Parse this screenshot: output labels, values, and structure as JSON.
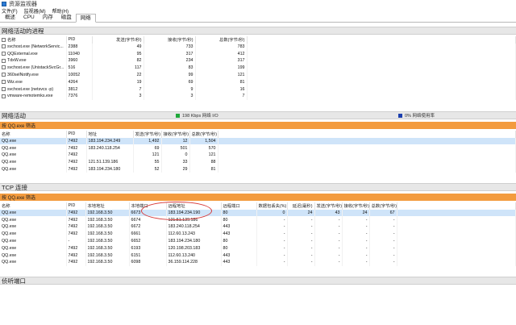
{
  "window": {
    "title": "资源监视器"
  },
  "menu": [
    "文件(F)",
    "监视器(M)",
    "帮助(H)"
  ],
  "tabs": [
    {
      "label": "概述",
      "active": false
    },
    {
      "label": "CPU",
      "active": false
    },
    {
      "label": "内存",
      "active": false
    },
    {
      "label": "磁盘",
      "active": false
    },
    {
      "label": "网络",
      "active": true
    }
  ],
  "processes": {
    "title": "网络活动的进程",
    "columns": [
      "名称",
      "PID",
      "发送(字节/秒)",
      "接收(字节/秒)",
      "总数(字节/秒)"
    ],
    "rows": [
      [
        "svchost.exe (NetworkServic...",
        "2388",
        "49",
        "733",
        "783"
      ],
      [
        "QQExternal.exe",
        "11040",
        "95",
        "317",
        "412"
      ],
      [
        "TdxW.exe",
        "3960",
        "82",
        "234",
        "317"
      ],
      [
        "svchost.exe (UnistackSvcGr...",
        "516",
        "117",
        "83",
        "199"
      ],
      [
        "360selNotify.exe",
        "10052",
        "22",
        "99",
        "121"
      ],
      [
        "Wiz.exe",
        "4264",
        "19",
        "69",
        "81"
      ],
      [
        "svchost.exe (netsvcs -p)",
        "3812",
        "7",
        "9",
        "16"
      ],
      [
        "vmware-remotemks.exe",
        "7376",
        "3",
        "3",
        "7"
      ]
    ]
  },
  "network_activity": {
    "title": "网络活动",
    "io_label": "198 Kbps 网络 I/O",
    "util_label": "0% 网络使用率",
    "io_color": "#1fa83a",
    "util_color": "#1c3fae",
    "filter": "按 QQ.exe 筛选",
    "columns": [
      "名称",
      "PID",
      "地址",
      "发送(字节/秒)",
      "接收(字节/秒)",
      "总数(字节/秒)"
    ],
    "rows": [
      [
        "QQ.exe",
        "7492",
        "183.194.234.249",
        "1,492",
        "12",
        "1,504"
      ],
      [
        "QQ.exe",
        "7492",
        "183.240.118.254",
        "69",
        "501",
        "570"
      ],
      [
        "QQ.exe",
        "7492",
        "",
        "121",
        "0",
        "121"
      ],
      [
        "QQ.exe",
        "7492",
        "121.51.139.186",
        "55",
        "33",
        "88"
      ],
      [
        "QQ.exe",
        "7492",
        "183.194.234.180",
        "52",
        "29",
        "81"
      ]
    ]
  },
  "tcp": {
    "title": "TCP 连接",
    "filter": "按 QQ.exe 筛选",
    "columns": [
      "名称",
      "PID",
      "本地地址",
      "本地端口",
      "远程地址",
      "远程端口",
      "数据包丢失(%)",
      "延迟(毫秒)",
      "发送(字节/秒)",
      "接收(字节/秒)",
      "总数(字节/秒)"
    ],
    "rows": [
      [
        "QQ.exe",
        "7492",
        "192.168.3.50",
        "6673",
        "183.194.234.190",
        "80",
        "0",
        "24",
        "43",
        "24",
        "67"
      ],
      [
        "QQ.exe",
        "7492",
        "192.168.3.50",
        "6674",
        "121.51.139.186",
        "80",
        "-",
        "-",
        "-",
        "-",
        "-"
      ],
      [
        "QQ.exe",
        "7492",
        "192.168.3.50",
        "6672",
        "183.240.118.254",
        "443",
        "-",
        "-",
        "-",
        "-",
        "-"
      ],
      [
        "QQ.exe",
        "7492",
        "192.168.3.50",
        "6661",
        "112.60.13.243",
        "443",
        "-",
        "-",
        "-",
        "-",
        "-"
      ],
      [
        "QQ.exe",
        "-",
        "192.168.3.50",
        "6652",
        "183.194.234.180",
        "80",
        "-",
        "-",
        "-",
        "-",
        "-"
      ],
      [
        "QQ.exe",
        "7492",
        "192.168.3.50",
        "6193",
        "120.198.203.183",
        "80",
        "-",
        "-",
        "-",
        "-",
        "-"
      ],
      [
        "QQ.exe",
        "7492",
        "192.168.3.50",
        "6151",
        "112.60.13.240",
        "443",
        "-",
        "-",
        "-",
        "-",
        "-"
      ],
      [
        "QQ.exe",
        "7492",
        "192.168.3.50",
        "6098",
        "36.159.114.228",
        "443",
        "-",
        "-",
        "-",
        "-",
        "-"
      ]
    ]
  },
  "listening": {
    "title": "侦听端口"
  }
}
